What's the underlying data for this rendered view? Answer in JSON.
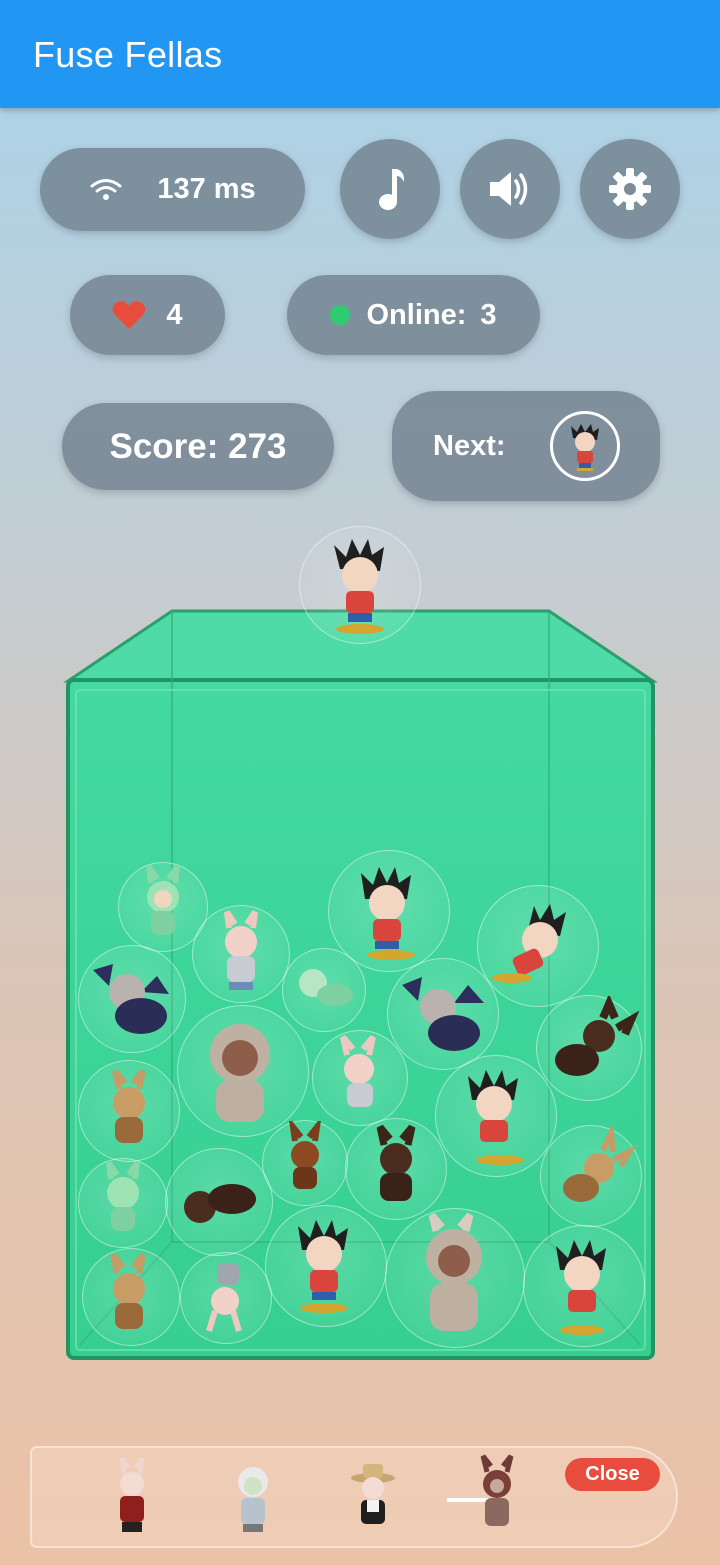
{
  "app": {
    "title": "Fuse Fellas"
  },
  "status": {
    "ping": "137 ms",
    "lives": "4",
    "online_label": "Online:",
    "online_count": "3",
    "score": "Score: 273",
    "next_label": "Next:"
  },
  "icons": {
    "wifi": "wifi-icon",
    "music": "music-note-icon",
    "sound": "volume-icon",
    "settings": "gear-icon",
    "heart": "heart-icon",
    "online_dot": "online-status-dot"
  },
  "colors": {
    "appbar": "#2196f3",
    "pill": "#6e7d8a",
    "box": "#3fd69a",
    "heart": "#e74c3c",
    "online": "#2ecc71",
    "close": "#e74c3c"
  },
  "tray": {
    "close_label": "Close",
    "items": [
      "red-outfit-labubu",
      "white-haired-labubu",
      "hat-labubu",
      "dark-zombie-labubu"
    ]
  }
}
